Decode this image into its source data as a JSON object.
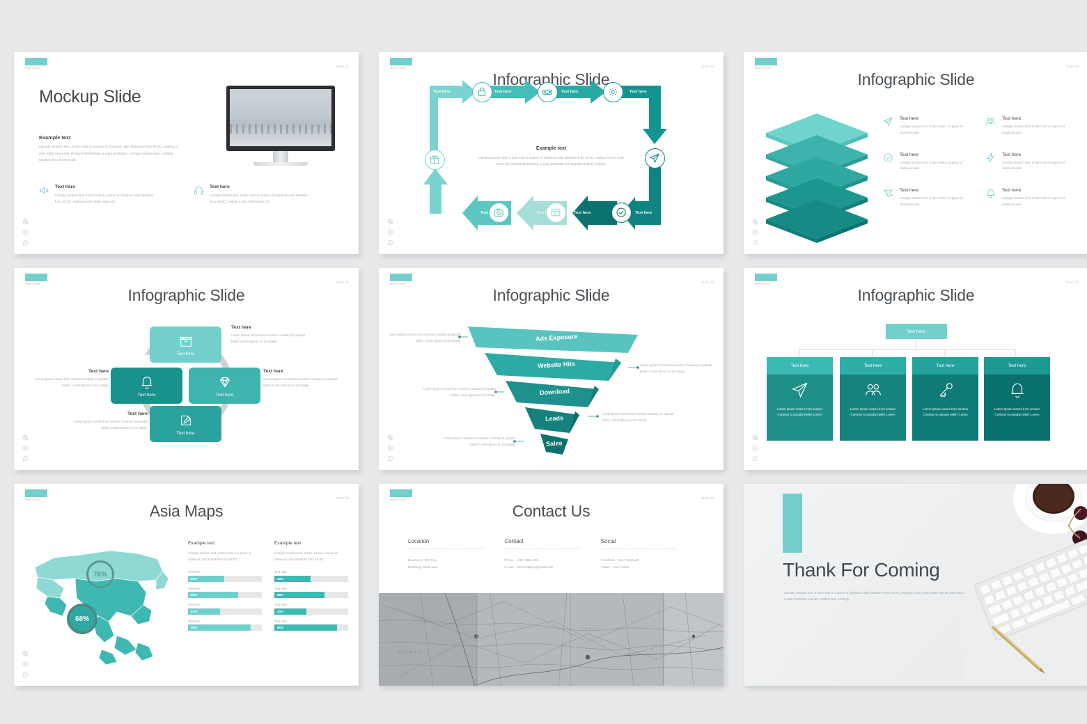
{
  "theme": {
    "accent_light": "#73cfcb",
    "accent_mid": "#3fb3ae",
    "accent_dark": "#1f8f8a",
    "accent_darkest": "#107a76",
    "text_dark": "#4a5055",
    "text_muted": "#a3a8ab",
    "page_bg": "#e8e9eb"
  },
  "common": {
    "brand": "Neero.com",
    "social_icons": [
      "dribbble-icon",
      "skype-icon",
      "whatsapp-icon"
    ]
  },
  "slides": [
    {
      "slide_number": "Slide 22",
      "title": "Mockup Slide",
      "subheading": "Example text",
      "body": "Lsimply random text. It has roots in a piece of classical Latin literature from 45 BC, making it over 2000 years old. Richard McClintock, a Latin professor. Lsimply random text. Lsimply random text. It has roots",
      "features": [
        {
          "icon": "speaker-icon",
          "heading": "Text here",
          "body": "Lsimply random text. It has roots in a piece of classical Latin literature from 45 BC, making it over 2000 years old."
        },
        {
          "icon": "headphones-icon",
          "heading": "Text here",
          "body": "Lsimply random text. It has roots in a piece of classical Latin literature from 45 BC, making it over 2000 years old."
        }
      ],
      "mockup_alt": "desktop-monitor-mockup"
    },
    {
      "slide_number": "Slide 23",
      "title": "Infographic Slide",
      "center_heading": "Example text",
      "center_body": "Lsimply random text. It has roots in a piece of classical Latin literature from 45 BC, making it over 2000 years old. Richard McClintock, a Latin professor at Hampden Sydney College.",
      "steps": [
        {
          "label": "Text here",
          "icon": "none"
        },
        {
          "label": "Text here",
          "icon": "lock-icon"
        },
        {
          "label": "Text here",
          "icon": "vr-goggles-icon"
        },
        {
          "label": "Text here",
          "icon": "gear-icon"
        },
        {
          "label": "Text here",
          "icon": "paper-plane-icon"
        },
        {
          "label": "Text here",
          "icon": "check-circle-icon"
        },
        {
          "label": "Text here",
          "icon": "browser-window-icon"
        },
        {
          "label": "Text here",
          "icon": "camera-icon"
        },
        {
          "label": "Text here",
          "icon": "gift-box-icon"
        }
      ]
    },
    {
      "slide_number": "Slide 24",
      "title": "Infographic Slide",
      "layers_alt": "stacked-layers-diagram",
      "items": [
        {
          "icon": "paper-plane-icon",
          "heading": "Text here",
          "body": "Lsimply random text. It has roots in a piece of classical Latin"
        },
        {
          "icon": "users-icon",
          "heading": "Text here",
          "body": "Lsimply random text. It has roots in a piece of classical Latin"
        },
        {
          "icon": "check-circle-icon",
          "heading": "Text here",
          "body": "Lsimply random text. It has roots in a piece of classical Latin"
        },
        {
          "icon": "bolt-icon",
          "heading": "Text here",
          "body": "Lsimply random text. It has roots in a piece of classical Latin"
        },
        {
          "icon": "funnel-add-icon",
          "heading": "Text here",
          "body": "Lsimply random text. It has roots in a piece of classical Latin"
        },
        {
          "icon": "bell-icon",
          "heading": "Text here",
          "body": "Lsimply random text. It has roots in a piece of classical Latin"
        }
      ]
    },
    {
      "slide_number": "Slide 25",
      "title": "Infographic Slide",
      "nodes": [
        {
          "position": "top",
          "icon": "archive-box-icon",
          "label": "Text here",
          "color": "#73cfcb"
        },
        {
          "position": "right",
          "icon": "diamond-icon",
          "label": "Text here",
          "color": "#3fb3ae"
        },
        {
          "position": "bottom",
          "icon": "edit-note-icon",
          "label": "Text here",
          "color": "#2aa39e"
        },
        {
          "position": "left",
          "icon": "bell-icon",
          "label": "Text here",
          "color": "#19918c"
        }
      ],
      "captions": [
        {
          "heading": "Text here",
          "body": "Lorem Ipsum comes from section Contrary to popular belief. Lorem Ipsum is not simply."
        },
        {
          "heading": "Text here",
          "body": "Lorem Ipsum comes from section Contrary to popular belief, Lorem Ipsum is not simply."
        },
        {
          "heading": "Text here",
          "body": "Lorem Ipsum comes from section Contrary to popular belief, Lorem Ipsum is not simply."
        },
        {
          "heading": "Text here",
          "body": "Lorem Ipsum comes from section Contrary to popular belief, Lorem Ipsum is not simply."
        }
      ]
    },
    {
      "slide_number": "Slide 26",
      "title": "Infographic Slide",
      "chart_data": {
        "type": "funnel",
        "title": "Infographic Slide",
        "categories": [
          "Ads Exposure",
          "Website Hits",
          "Download",
          "Leads",
          "Sales"
        ],
        "values": [
          100,
          78,
          56,
          37,
          20
        ],
        "colors": [
          "#59c4bf",
          "#2eaaa5",
          "#1f918d",
          "#15807c",
          "#0e716e"
        ],
        "annotations": [
          "Lorem Ipsum comes from section Contrary to popular belief, Lorem Ipsum is not simply.",
          "Lorem Ipsum comes from section Contrary to popular belief, Lorem Ipsum is not simply.",
          "Lorem Ipsum comes from section Contrary to popular belief, Lorem Ipsum is not simply.",
          "Lorem Ipsum comes from section Contrary to popular belief, Lorem Ipsum is not simply.",
          "Lorem Ipsum comes from section Contrary to popular belief, Lorem Ipsum is not simply."
        ]
      }
    },
    {
      "slide_number": "Slide 27",
      "title": "Infographic Slide",
      "root_label": "Text here",
      "cards": [
        {
          "header": "Text here",
          "icon": "paper-plane-icon",
          "body": "Lorem Ipsum comes from section Contrary to popular belief, Lorem",
          "head_color": "#3cb9b4",
          "body_color": "#1f8f8a"
        },
        {
          "header": "Text here",
          "icon": "users-icon",
          "body": "Lorem Ipsum comes from section Contrary to popular belief, Lorem",
          "head_color": "#2fada8",
          "body_color": "#17837f"
        },
        {
          "header": "Text here",
          "icon": "key-icon",
          "body": "Lorem Ipsum comes from section Contrary to popular belief, Lorem",
          "head_color": "#25a29d",
          "body_color": "#107a76"
        },
        {
          "header": "Text here",
          "icon": "bell-icon",
          "body": "Lorem Ipsum comes from section Contrary to popular belief, Lorem",
          "head_color": "#1e9995",
          "body_color": "#0b716e"
        }
      ]
    },
    {
      "slide_number": "Slide 28",
      "title": "Asia Maps",
      "chart_data": {
        "type": "bar",
        "title": "Asia Maps",
        "donuts": [
          {
            "label": "76%",
            "value": 76
          },
          {
            "label": "68%",
            "value": 68
          }
        ],
        "columns": [
          {
            "heading": "Example text",
            "desc": "Lsimply random text. It has roots in a piece of classical Latin literature from 45 BC.",
            "categories": [
              "Text here",
              "Text here",
              "Text here",
              "Text here"
            ],
            "values": [
              49,
              68,
              43,
              85
            ],
            "labels": [
              "49%",
              "68%",
              "43%",
              "85%"
            ],
            "fill_color": "#6fd0cb"
          },
          {
            "heading": "Example text",
            "desc": "Lsimply random text. It has roots in a piece of classical Latin literature from 45 BC.",
            "categories": [
              "Text here",
              "Text here",
              "Text here",
              "Text here"
            ],
            "values": [
              49,
              68,
              43,
              85
            ],
            "labels": [
              "49%",
              "68%",
              "43%",
              "85%"
            ],
            "fill_color": "#3fb8b3"
          }
        ],
        "xlabel": "",
        "ylabel": "",
        "ylim": [
          0,
          100
        ],
        "grid": false
      }
    },
    {
      "slide_number": "Slide 29",
      "title": "Contact Us",
      "columns": [
        {
          "heading": "Location",
          "lines": [
            "Boulevard, 113 Troy",
            "Bandung, West Java"
          ]
        },
        {
          "heading": "Contact",
          "lines": [
            "Phone  :  +022-2564-220",
            "E-mail :  yourcompany@gmail.com"
          ]
        },
        {
          "heading": "Social",
          "lines": [
            "Facebook : Your Facebook",
            "Twitter     : Your Twitter"
          ]
        }
      ],
      "map_alt": "vintage-paper-map-photo"
    },
    {
      "slide_number": "",
      "title": "Thank For Coming",
      "body": "Lsimply random text. It has roots in a piece of classical Latin literature from 45 BC, making it over 2000 years old. Richard McClintock, a Latin professo Lsimply random text. Lsimply.",
      "photo_alt": "keyboard-coffee-cherries-photo"
    }
  ]
}
